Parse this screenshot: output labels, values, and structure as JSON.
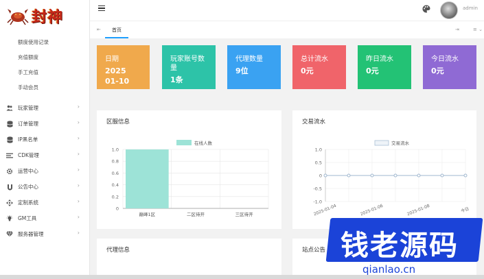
{
  "brand": {
    "logo_text": "封神"
  },
  "sidebar": {
    "sub_items": [
      "额度使用记录",
      "充值额度",
      "手工充值",
      "手动会员"
    ],
    "items": [
      {
        "label": "玩家管理",
        "icon": "users-icon"
      },
      {
        "label": "订单管理",
        "icon": "database-icon"
      },
      {
        "label": "IP黑名单",
        "icon": "database-icon"
      },
      {
        "label": "CDK管理",
        "icon": "list-icon"
      },
      {
        "label": "运营中心",
        "icon": "gear-icon"
      },
      {
        "label": "公告中心",
        "icon": "magnet-icon"
      },
      {
        "label": "定制系统",
        "icon": "diamond-arrows-icon"
      },
      {
        "label": "GM工具",
        "icon": "bulb-icon"
      },
      {
        "label": "服务器管理",
        "icon": "gem-icon"
      }
    ]
  },
  "header": {
    "username": "admin"
  },
  "tabs": {
    "home_label": "首页"
  },
  "cards": [
    {
      "title": "日期",
      "value": "2025\n01-10",
      "color": "#f0a94c"
    },
    {
      "title": "玩家账号数量",
      "value": "1条",
      "color": "#2dc3a8"
    },
    {
      "title": "代理数量",
      "value": "9位",
      "color": "#3aa2f2"
    },
    {
      "title": "总计流水",
      "value": "0元",
      "color": "#f0646a"
    },
    {
      "title": "昨日流水",
      "value": "0元",
      "color": "#23c275"
    },
    {
      "title": "今日流水",
      "value": "0元",
      "color": "#8f6ad4"
    }
  ],
  "panels": {
    "region": "区服信息",
    "trade": "交易流水",
    "agent": "代理信息",
    "notice": "站点公告"
  },
  "chart_data": [
    {
      "type": "bar",
      "categories": [
        "巅峰1区",
        "二区待开",
        "三区待开"
      ],
      "series": [
        {
          "name": "在线人数",
          "values": [
            1,
            0,
            0
          ],
          "color": "#9de3d7"
        }
      ],
      "ylim": [
        0,
        1.0
      ],
      "yticks": [
        "0",
        "0.2",
        "0.4",
        "0.6",
        "0.8",
        "1.0"
      ],
      "grid": true,
      "legend": "top"
    },
    {
      "type": "line",
      "x": [
        "2025-01-04",
        "2025-01-05",
        "2025-01-06",
        "2025-01-07",
        "2025-01-08",
        "2025-01-09",
        "今日"
      ],
      "x_tick_labels": [
        "2025-01-04",
        "2025-01-06",
        "2025-01-08",
        "今日"
      ],
      "series": [
        {
          "name": "交易流水",
          "values": [
            0,
            0,
            0,
            0,
            0,
            0,
            0
          ],
          "color": "#9fb7cf"
        }
      ],
      "ylim": [
        -1.0,
        1.0
      ],
      "yticks": [
        "-1.0",
        "-0.5",
        "0",
        "0.5",
        "1.0"
      ],
      "grid": true,
      "legend": "top"
    }
  ],
  "watermark": {
    "text": "钱老源码",
    "url": "qianlao.cn"
  }
}
